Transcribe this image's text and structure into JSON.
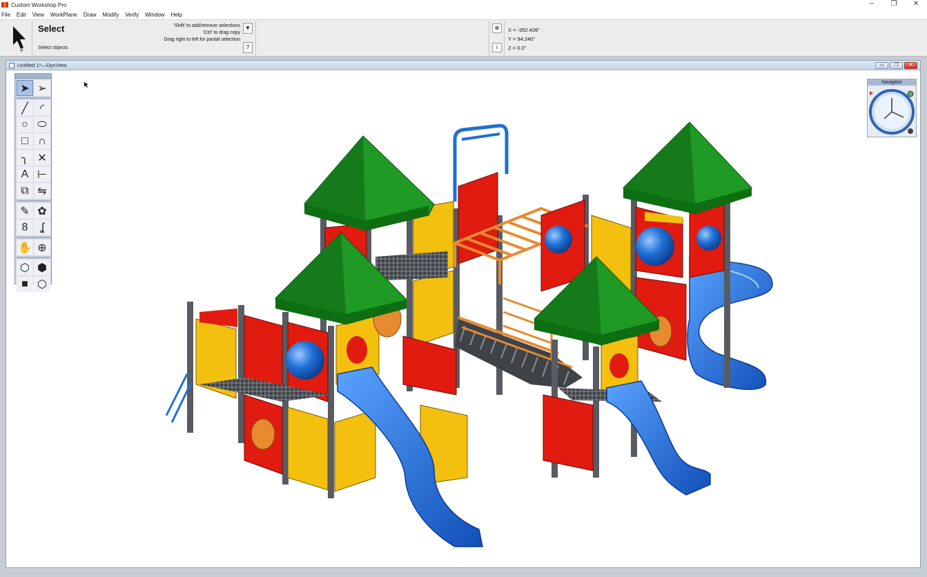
{
  "app": {
    "title": "Custom Workshop Pro",
    "window_controls": [
      "–",
      "❐",
      "✕"
    ]
  },
  "menu": [
    "File",
    "Edit",
    "View",
    "WorkPlane",
    "Draw",
    "Modify",
    "Verify",
    "Window",
    "Help"
  ],
  "toolbar": {
    "tool_name": "Select",
    "prompt": "Select objects",
    "hints": [
      "'Shift' to add/remove selections",
      "'Ctrl' to drag copy",
      "Drag right to left for partial selection"
    ],
    "hint_buttons": [
      "▼",
      "?"
    ],
    "coord_buttons": [
      "⊕",
      "i"
    ],
    "coords": {
      "x": "X = -352.439\"",
      "y": "Y = 94.240\"",
      "z": "Z = 0.0\""
    }
  },
  "document": {
    "title": "Untitled 1*—DynView",
    "controls": [
      "▭",
      "❐",
      "✕"
    ]
  },
  "palette_icons": [
    "select-arrow-icon",
    "select-hollow-arrow-icon",
    "line-icon",
    "arc-icon",
    "circle-icon",
    "ellipse-icon",
    "rectangle-icon",
    "curve-icon",
    "fillet-icon",
    "trim-icon",
    "text-icon",
    "dimension-icon",
    "scale-icon",
    "mirror-icon",
    "paint-icon",
    "boolean-icon",
    "extrude-icon",
    "sweep-icon",
    "pan-hand-icon",
    "zoom-icon",
    "view-iso-icon",
    "view-top-icon",
    "view-side-icon",
    "render-solid-icon",
    "render-wire-icon",
    "render-mode-icon"
  ],
  "navigator": {
    "title": "Navigator"
  },
  "colors": {
    "roof": "#1f9a24",
    "panel_red": "#e11b10",
    "panel_yellow": "#f4c010",
    "slide_blue": "#1f6fd6",
    "post": "#555a60",
    "bar_orange": "#e88a30"
  }
}
